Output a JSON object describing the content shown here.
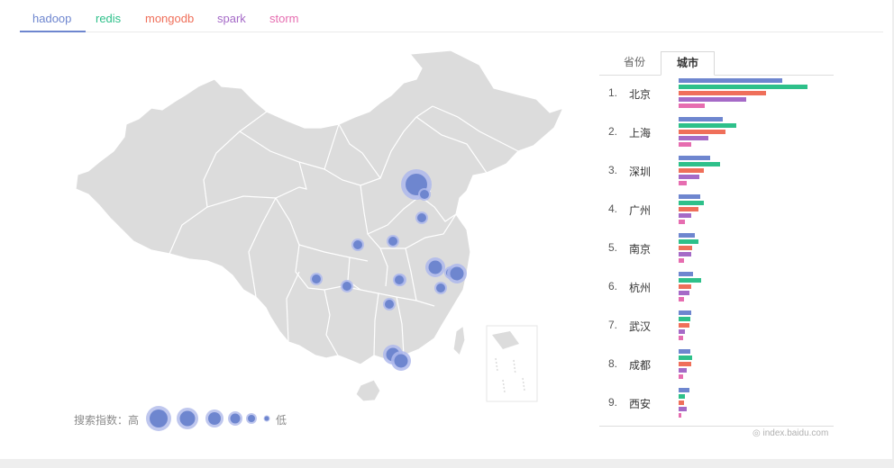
{
  "tabs": [
    {
      "label": "hadoop",
      "color": "#6e86cf",
      "active": true
    },
    {
      "label": "redis",
      "color": "#2ec08a"
    },
    {
      "label": "mongodb",
      "color": "#ef6f5a"
    },
    {
      "label": "spark",
      "color": "#a56ac7"
    },
    {
      "label": "storm",
      "color": "#e66db0"
    }
  ],
  "legend": {
    "prefix": "搜索指数：高",
    "suffix": "低"
  },
  "rank_tabs": {
    "province": "省份",
    "city": "城市"
  },
  "cities": [
    {
      "rank": "1.",
      "name": "北京",
      "values": [
        100,
        124,
        84,
        65,
        25
      ]
    },
    {
      "rank": "2.",
      "name": "上海",
      "values": [
        43,
        56,
        45,
        29,
        12
      ]
    },
    {
      "rank": "3.",
      "name": "深圳",
      "values": [
        30,
        40,
        24,
        20,
        8
      ]
    },
    {
      "rank": "4.",
      "name": "广州",
      "values": [
        21,
        24,
        19,
        12,
        6
      ]
    },
    {
      "rank": "5.",
      "name": "南京",
      "values": [
        16,
        19,
        13,
        12,
        5
      ]
    },
    {
      "rank": "6.",
      "name": "杭州",
      "values": [
        14,
        22,
        12,
        10,
        5
      ]
    },
    {
      "rank": "7.",
      "name": "武汉",
      "values": [
        12,
        11,
        10,
        6,
        4
      ]
    },
    {
      "rank": "8.",
      "name": "成都",
      "values": [
        11,
        13,
        12,
        8,
        4
      ]
    },
    {
      "rank": "9.",
      "name": "西安",
      "values": [
        10,
        6,
        5,
        8,
        3
      ]
    }
  ],
  "map_bubbles": [
    {
      "city": "北京",
      "level": 5
    },
    {
      "city": "天津",
      "level": 2
    },
    {
      "city": "石家庄",
      "level": 2
    },
    {
      "city": "太原",
      "level": 2
    },
    {
      "city": "西安",
      "level": 2
    },
    {
      "city": "郑州",
      "level": 2
    },
    {
      "city": "成都",
      "level": 2
    },
    {
      "city": "重庆",
      "level": 2
    },
    {
      "city": "武汉",
      "level": 2
    },
    {
      "city": "长沙",
      "level": 2
    },
    {
      "city": "合肥",
      "level": 2
    },
    {
      "city": "南京",
      "level": 3
    },
    {
      "city": "上海",
      "level": 3
    },
    {
      "city": "杭州",
      "level": 2
    },
    {
      "city": "广州",
      "level": 3
    },
    {
      "city": "深圳",
      "level": 3
    }
  ],
  "credit": "◎ index.baidu.com"
}
